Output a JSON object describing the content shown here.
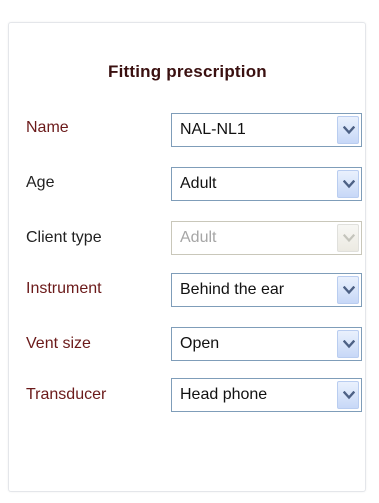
{
  "panel": {
    "title": "Fitting prescription"
  },
  "fields": {
    "name": {
      "label": "Name",
      "value": "NAL-NL1"
    },
    "age": {
      "label": "Age",
      "value": "Adult"
    },
    "client_type": {
      "label": "Client type",
      "value": "Adult",
      "disabled": true
    },
    "instrument": {
      "label": "Instrument",
      "value": "Behind the ear"
    },
    "vent_size": {
      "label": "Vent size",
      "value": "Open"
    },
    "transducer": {
      "label": "Transducer",
      "value": "Head phone"
    }
  },
  "icons": {
    "dropdown": "chevron-down-icon"
  },
  "colors": {
    "label_maroon": "#6b1a1a",
    "label_dark": "#222222",
    "title": "#3a1010",
    "combo_border": "#7f9db9",
    "arrow_blue": "#4d6185",
    "disabled_text": "#a6a6a6"
  }
}
